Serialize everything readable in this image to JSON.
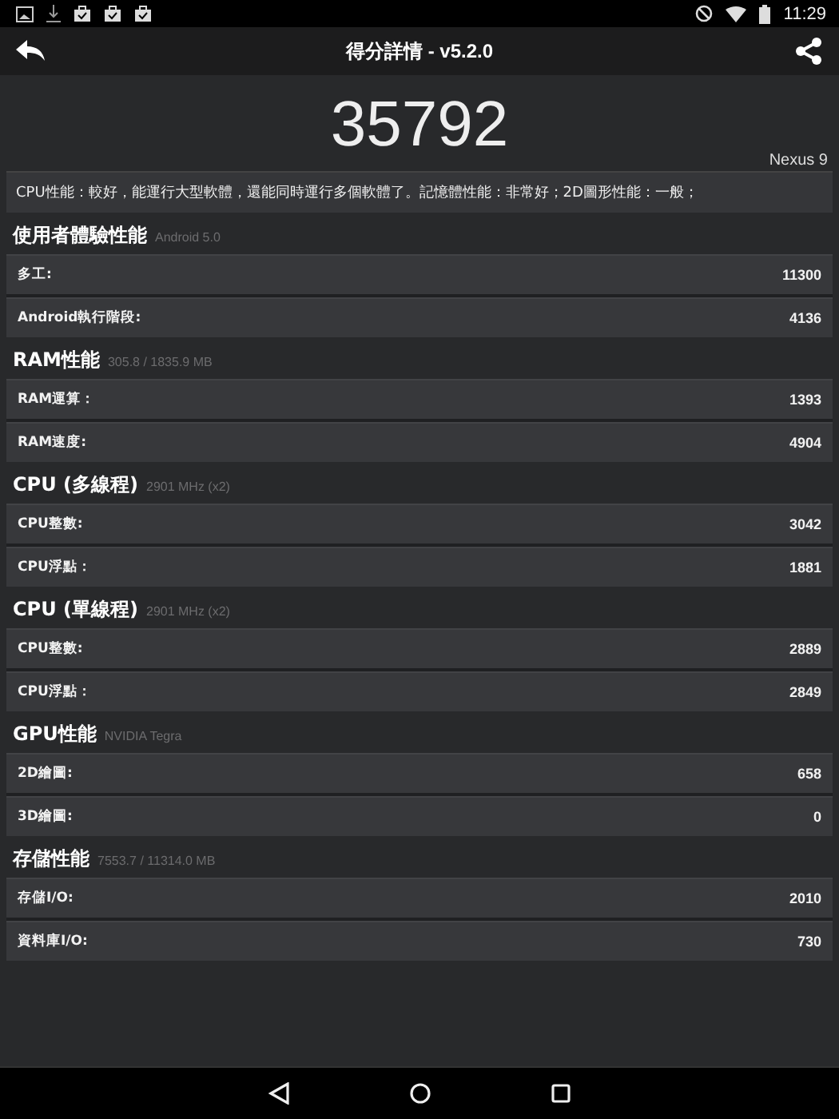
{
  "status_bar": {
    "time": "11:29"
  },
  "app_bar": {
    "title": "得分詳情 - v5.2.0"
  },
  "score": {
    "value": "35792",
    "device": "Nexus 9"
  },
  "summary": "CPU性能：較好，能運行大型軟體，還能同時運行多個軟體了。記憶體性能：非常好；2D圖形性能：一般；",
  "sections": [
    {
      "title": "使用者體驗性能",
      "subtitle": "Android 5.0",
      "rows": [
        {
          "label": "多工:",
          "value": "11300"
        },
        {
          "label": "Android執行階段:",
          "value": "4136"
        }
      ]
    },
    {
      "title": "RAM性能",
      "subtitle": "305.8 / 1835.9 MB",
      "rows": [
        {
          "label": "RAM運算：",
          "value": "1393"
        },
        {
          "label": "RAM速度:",
          "value": "4904"
        }
      ]
    },
    {
      "title": "CPU (多線程)",
      "subtitle": "2901 MHz (x2)",
      "rows": [
        {
          "label": "CPU整數:",
          "value": "3042"
        },
        {
          "label": "CPU浮點：",
          "value": "1881"
        }
      ]
    },
    {
      "title": "CPU (單線程)",
      "subtitle": "2901 MHz (x2)",
      "rows": [
        {
          "label": "CPU整數:",
          "value": "2889"
        },
        {
          "label": "CPU浮點：",
          "value": "2849"
        }
      ]
    },
    {
      "title": "GPU性能",
      "subtitle": "NVIDIA Tegra",
      "rows": [
        {
          "label": "2D繪圖:",
          "value": "658"
        },
        {
          "label": "3D繪圖:",
          "value": "0"
        }
      ]
    },
    {
      "title": "存儲性能",
      "subtitle": "7553.7 / 11314.0 MB",
      "rows": [
        {
          "label": "存儲I/O:",
          "value": "2010"
        },
        {
          "label": "資料庫I/O:",
          "value": "730"
        }
      ]
    }
  ]
}
